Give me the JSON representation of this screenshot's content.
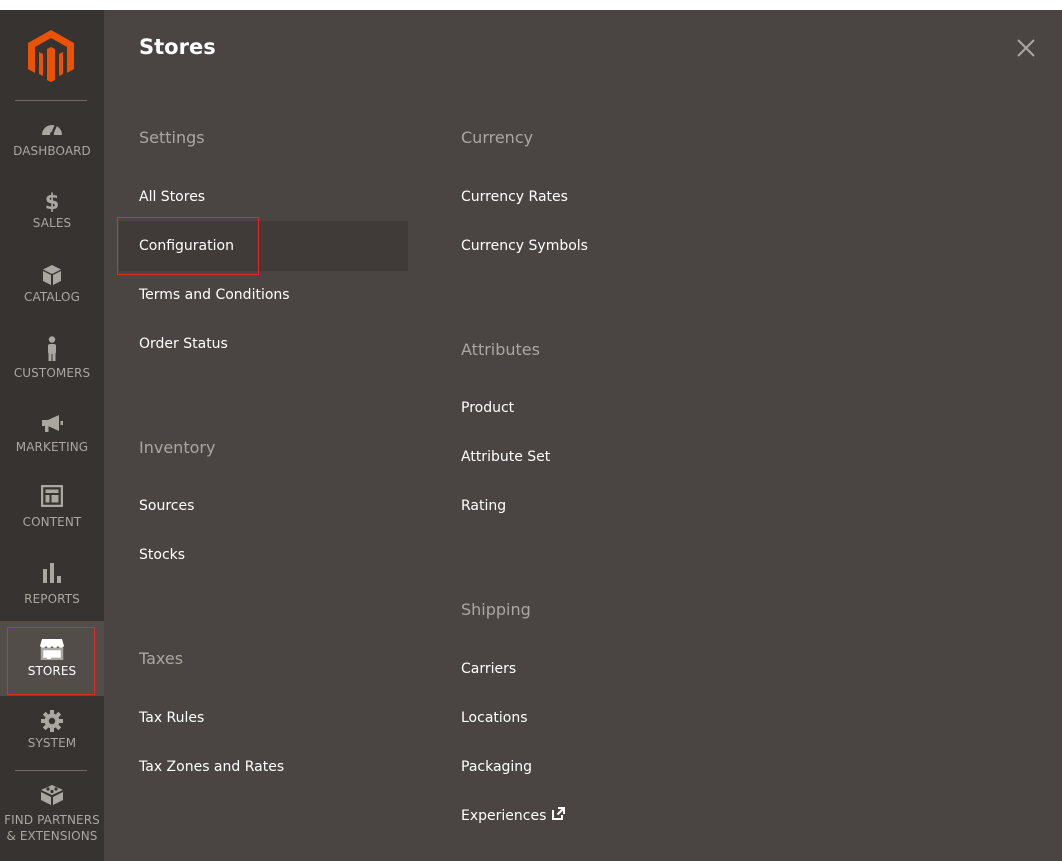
{
  "sidebar": {
    "logo": "magento-logo-icon",
    "items": [
      {
        "label": "DASHBOARD",
        "icon": "dashboard-icon"
      },
      {
        "label": "SALES",
        "icon": "dollar-icon"
      },
      {
        "label": "CATALOG",
        "icon": "box-icon"
      },
      {
        "label": "CUSTOMERS",
        "icon": "person-icon"
      },
      {
        "label": "MARKETING",
        "icon": "megaphone-icon"
      },
      {
        "label": "CONTENT",
        "icon": "layout-icon"
      },
      {
        "label": "REPORTS",
        "icon": "bar-chart-icon"
      },
      {
        "label": "STORES",
        "icon": "storefront-icon",
        "active": true
      },
      {
        "label": "SYSTEM",
        "icon": "gear-icon"
      },
      {
        "label": "FIND PARTNERS\n& EXTENSIONS",
        "icon": "blocks-icon"
      }
    ]
  },
  "panel": {
    "title": "Stores",
    "close_icon": "close-icon",
    "left_column": [
      {
        "heading": "Settings",
        "links": [
          "All Stores",
          "Configuration",
          "Terms and Conditions",
          "Order Status"
        ]
      },
      {
        "heading": "Inventory",
        "links": [
          "Sources",
          "Stocks"
        ]
      },
      {
        "heading": "Taxes",
        "links": [
          "Tax Rules",
          "Tax Zones and Rates"
        ]
      }
    ],
    "right_column": [
      {
        "heading": "Currency",
        "links": [
          "Currency Rates",
          "Currency Symbols"
        ]
      },
      {
        "heading": "Attributes",
        "links": [
          "Product",
          "Attribute Set",
          "Rating"
        ]
      },
      {
        "heading": "Shipping",
        "links": [
          "Carriers",
          "Locations",
          "Packaging",
          "Experiences"
        ]
      }
    ],
    "external_link_icon": "external-link-icon"
  },
  "colors": {
    "sidebar_bg": "#373330",
    "panel_bg": "#4a4542",
    "active_bg": "#524d49",
    "heading_text": "#aaa6a0",
    "link_text": "#ffffff",
    "brand_orange": "#eb5202",
    "highlight_border": "#e02b27"
  }
}
